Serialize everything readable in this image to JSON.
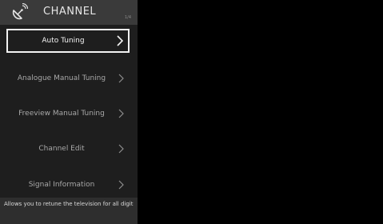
{
  "screen": {
    "background": "#000000"
  },
  "panel": {
    "title": "CHANNEL",
    "page_indicator": "1/4",
    "icon": "satellite-dish-icon"
  },
  "menu": {
    "items": [
      {
        "label": "Auto Tuning",
        "selected": true
      },
      {
        "label": "Analogue Manual Tuning",
        "selected": false
      },
      {
        "label": "Freeview Manual Tuning",
        "selected": false
      },
      {
        "label": "Channel Edit",
        "selected": false
      },
      {
        "label": "Signal Information",
        "selected": false
      }
    ]
  },
  "description": {
    "text": "Allows you to retune the television for all digit"
  },
  "colors": {
    "panel_bg": "#1e1e1e",
    "header_bg": "#3a3a3a",
    "selection_border": "#f2f2f2",
    "item_text": "#a8a8a8"
  }
}
